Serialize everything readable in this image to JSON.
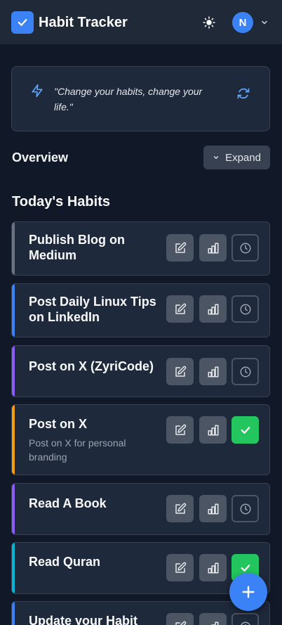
{
  "header": {
    "title": "Habit Tracker",
    "logo_icon": "check-icon",
    "theme_icon": "sun-icon",
    "avatar_initial": "N",
    "menu_icon": "chevron-down-icon"
  },
  "quote": {
    "text": "\"Change your habits, change your life.\"",
    "icon": "bolt-icon",
    "refresh_icon": "refresh-icon"
  },
  "overview": {
    "title": "Overview",
    "expand_label": "Expand"
  },
  "today": {
    "title": "Today's Habits"
  },
  "habits": [
    {
      "name": "Publish Blog on Medium",
      "description": "",
      "stripe_color": "#6b7280",
      "status": "pending"
    },
    {
      "name": "Post Daily Linux Tips on LinkedIn",
      "description": "",
      "stripe_color": "#3b82f6",
      "status": "pending"
    },
    {
      "name": "Post on X (ZyriCode)",
      "description": "",
      "stripe_color": "#8b5cf6",
      "status": "pending"
    },
    {
      "name": "Post on X",
      "description": "Post on X for personal branding",
      "stripe_color": "#f59e0b",
      "status": "done"
    },
    {
      "name": "Read A Book",
      "description": "",
      "stripe_color": "#8b5cf6",
      "status": "pending"
    },
    {
      "name": "Read Quran",
      "description": "",
      "stripe_color": "#06b6d4",
      "status": "done"
    },
    {
      "name": "Update your Habit",
      "description": "",
      "stripe_color": "#3b82f6",
      "status": "pending"
    }
  ],
  "colors": {
    "accent": "#3b82f6",
    "success": "#22c55e",
    "background": "#111827",
    "card": "#1e293b"
  },
  "fab_icon": "plus-icon"
}
